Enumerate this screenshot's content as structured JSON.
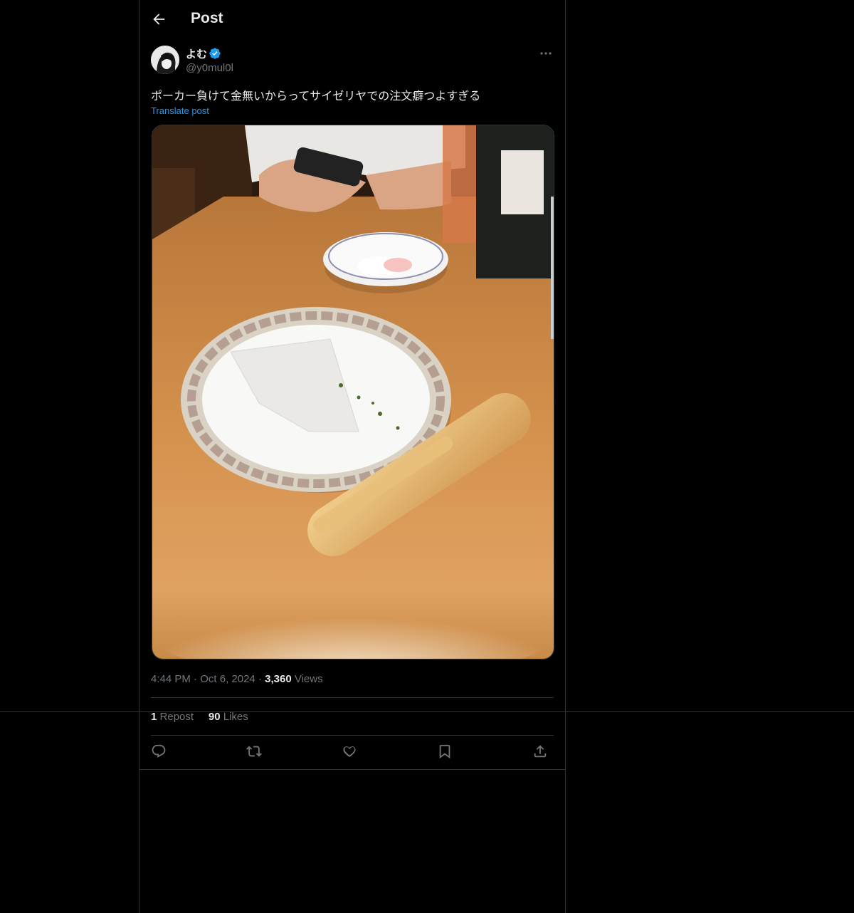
{
  "header": {
    "title": "Post",
    "back_icon": "arrow-left-icon"
  },
  "author": {
    "name": "よむ",
    "handle": "@y0mul0l",
    "verified": true,
    "verified_color": "#1d9bf0"
  },
  "post": {
    "text": "ポーカー負けて金無いからってサイゼリヤでの注文癖つよすぎる",
    "translate_label": "Translate post"
  },
  "meta": {
    "time": "4:44 PM",
    "date": "Oct 6, 2024",
    "views_count": "3,360",
    "views_label": "Views"
  },
  "stats": {
    "reposts_count": "1",
    "reposts_label": "Repost",
    "likes_count": "90",
    "likes_label": "Likes"
  },
  "actions": [
    "reply-icon",
    "repost-icon",
    "like-icon",
    "bookmark-icon",
    "share-icon"
  ],
  "colors": {
    "background": "#000000",
    "text": "#e7e9ea",
    "muted": "#71767b",
    "accent": "#1d9bf0",
    "border": "#2f3336"
  }
}
